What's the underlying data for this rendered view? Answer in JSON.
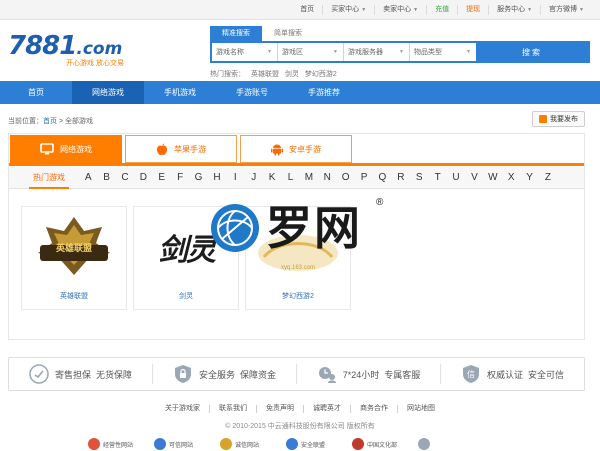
{
  "topbar": {
    "items": [
      {
        "label": "首页",
        "caret": false,
        "color": "normal"
      },
      {
        "label": "买家中心",
        "caret": true,
        "color": "normal"
      },
      {
        "label": "卖家中心",
        "caret": true,
        "color": "normal"
      },
      {
        "label": "充值",
        "caret": false,
        "color": "green"
      },
      {
        "label": "提现",
        "caret": false,
        "color": "orange"
      },
      {
        "label": "服务中心",
        "caret": true,
        "color": "normal"
      },
      {
        "label": "官方微博",
        "caret": true,
        "color": "normal"
      }
    ]
  },
  "logo": {
    "brand_main": "7881",
    "brand_suffix": ".com",
    "tagline": "开心游戏  放心交易"
  },
  "search": {
    "tabs": [
      "精准搜索",
      "简单搜索"
    ],
    "active_tab": 0,
    "selects": [
      "游戏名称",
      "游戏区",
      "游戏服务器",
      "物品类型"
    ],
    "button_label": "搜索",
    "hot_label": "热门搜索：",
    "hot_items": [
      "英雄联盟",
      "剑灵",
      "梦幻西游2"
    ]
  },
  "nav": {
    "items": [
      "首页",
      "网络游戏",
      "手机游戏",
      "手游账号",
      "手游推荐"
    ],
    "active": 1
  },
  "breadcrumb": {
    "prefix": "当前位置：",
    "home": "首页",
    "sep": " > ",
    "current": "全部游戏"
  },
  "publish_button": {
    "label": "我要发布"
  },
  "category_tabs": [
    {
      "label": "网络游戏",
      "icon": "monitor-icon",
      "active": true
    },
    {
      "label": "苹果手游",
      "icon": "apple-icon",
      "active": false
    },
    {
      "label": "安卓手游",
      "icon": "android-icon",
      "active": false
    }
  ],
  "alpha_filter": {
    "hot_label": "热门游戏",
    "letters": [
      "A",
      "B",
      "C",
      "D",
      "E",
      "F",
      "G",
      "H",
      "I",
      "J",
      "K",
      "L",
      "M",
      "N",
      "O",
      "P",
      "Q",
      "R",
      "S",
      "T",
      "U",
      "V",
      "W",
      "X",
      "Y",
      "Z"
    ]
  },
  "games": [
    {
      "name": "英雄联盟",
      "logo_text": "英雄联盟"
    },
    {
      "name": "剑灵",
      "logo_text": "剑灵"
    },
    {
      "name": "梦幻西游2",
      "logo_text": "xyq.163.com"
    }
  ],
  "watermark": {
    "text": "罗网",
    "reg": "®"
  },
  "guarantees": [
    {
      "icon": "shield-hand-icon",
      "title": "寄售担保",
      "sub": "无货保障"
    },
    {
      "icon": "lock-shield-icon",
      "title": "安全服务",
      "sub": "保障资金"
    },
    {
      "icon": "clock-person-icon",
      "title": "7*24小时",
      "sub": "专属客服"
    },
    {
      "icon": "certificate-icon",
      "title": "权威认证",
      "sub": "安全可信"
    }
  ],
  "footer": {
    "links": [
      "关于游戏家",
      "联系我们",
      "免责声明",
      "诚聘英才",
      "商务合作",
      "网站地图"
    ],
    "copyright": "© 2010-2015 中云通科技股份有限公司 版权所有",
    "badges": [
      "经营性网站",
      "可信网站",
      "诚信网站",
      "安全联盟",
      "中国文化部",
      ""
    ]
  },
  "colors": {
    "primary_blue": "#2d7fd6",
    "nav_active": "#1a63b4",
    "accent_orange": "#ff7e00",
    "link_blue": "#2d6fb8"
  }
}
